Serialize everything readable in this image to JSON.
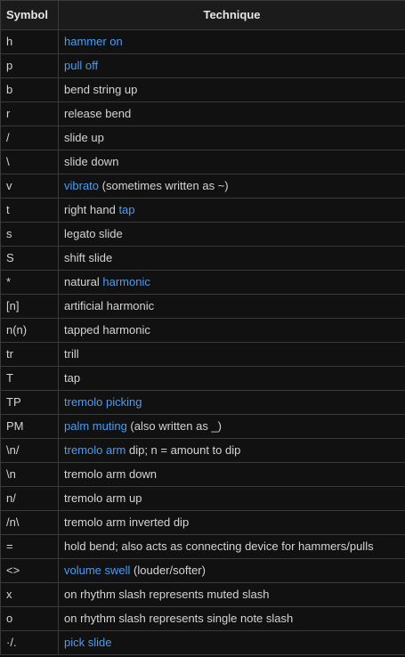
{
  "table": {
    "headers": {
      "symbol": "Symbol",
      "technique": "Technique"
    },
    "rows": [
      {
        "symbol": "h",
        "parts": [
          {
            "text": "hammer on",
            "link": true
          }
        ]
      },
      {
        "symbol": "p",
        "parts": [
          {
            "text": "pull off",
            "link": true
          }
        ]
      },
      {
        "symbol": "b",
        "parts": [
          {
            "text": "bend string up",
            "link": false
          }
        ]
      },
      {
        "symbol": "r",
        "parts": [
          {
            "text": "release bend",
            "link": false
          }
        ]
      },
      {
        "symbol": "/",
        "parts": [
          {
            "text": "slide up",
            "link": false
          }
        ]
      },
      {
        "symbol": "\\",
        "parts": [
          {
            "text": "slide down",
            "link": false
          }
        ]
      },
      {
        "symbol": "v",
        "parts": [
          {
            "text": "vibrato",
            "link": true
          },
          {
            "text": " (sometimes written as ~)",
            "link": false
          }
        ]
      },
      {
        "symbol": "t",
        "parts": [
          {
            "text": "right hand ",
            "link": false
          },
          {
            "text": "tap",
            "link": true
          }
        ]
      },
      {
        "symbol": "s",
        "parts": [
          {
            "text": "legato slide",
            "link": false
          }
        ]
      },
      {
        "symbol": "S",
        "parts": [
          {
            "text": "shift slide",
            "link": false
          }
        ]
      },
      {
        "symbol": "*",
        "parts": [
          {
            "text": "natural ",
            "link": false
          },
          {
            "text": "harmonic",
            "link": true
          }
        ]
      },
      {
        "symbol": "[n]",
        "parts": [
          {
            "text": "artificial harmonic",
            "link": false
          }
        ]
      },
      {
        "symbol": "n(n)",
        "parts": [
          {
            "text": "tapped harmonic",
            "link": false
          }
        ]
      },
      {
        "symbol": "tr",
        "parts": [
          {
            "text": "trill",
            "link": false
          }
        ]
      },
      {
        "symbol": "T",
        "parts": [
          {
            "text": "tap",
            "link": false
          }
        ]
      },
      {
        "symbol": "TP",
        "parts": [
          {
            "text": "tremolo picking",
            "link": true
          }
        ]
      },
      {
        "symbol": "PM",
        "parts": [
          {
            "text": "palm muting",
            "link": true
          },
          {
            "text": " (also written as _)",
            "link": false
          }
        ]
      },
      {
        "symbol": "\\n/",
        "parts": [
          {
            "text": "tremolo arm",
            "link": true
          },
          {
            "text": " dip; n = amount to dip",
            "link": false
          }
        ]
      },
      {
        "symbol": "\\n",
        "parts": [
          {
            "text": "tremolo arm down",
            "link": false
          }
        ]
      },
      {
        "symbol": "n/",
        "parts": [
          {
            "text": "tremolo arm up",
            "link": false
          }
        ]
      },
      {
        "symbol": "/n\\",
        "parts": [
          {
            "text": "tremolo arm inverted dip",
            "link": false
          }
        ]
      },
      {
        "symbol": "=",
        "parts": [
          {
            "text": "hold bend; also acts as connecting device for hammers/pulls",
            "link": false
          }
        ]
      },
      {
        "symbol": "<>",
        "parts": [
          {
            "text": "volume swell",
            "link": true
          },
          {
            "text": " (louder/softer)",
            "link": false
          }
        ]
      },
      {
        "symbol": "x",
        "parts": [
          {
            "text": "on rhythm slash represents muted slash",
            "link": false
          }
        ]
      },
      {
        "symbol": "o",
        "parts": [
          {
            "text": "on rhythm slash represents single note slash",
            "link": false
          }
        ]
      },
      {
        "symbol": "·/.",
        "parts": [
          {
            "text": "pick slide",
            "link": true
          }
        ]
      }
    ]
  },
  "colors": {
    "background": "#0d0d0d",
    "header_background": "#1b1b1b",
    "border": "#3a3a3a",
    "text": "#d4d4d4",
    "link": "#4a9cf5"
  }
}
